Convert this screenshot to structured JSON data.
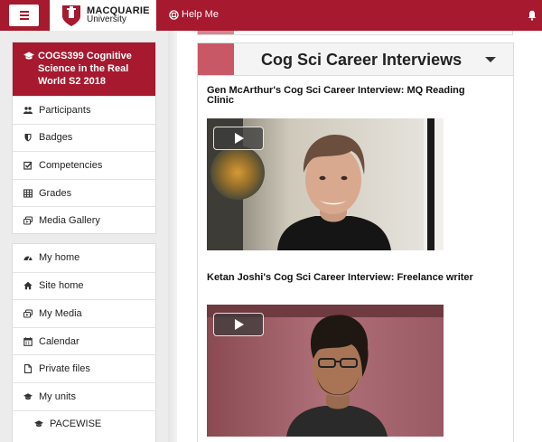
{
  "header": {
    "logo_line1": "MACQUARIE",
    "logo_line2": "University",
    "help_label": "Help Me"
  },
  "course": {
    "title": "COGS399 Cognitive Science in the Real World S2 2018",
    "items": [
      {
        "label": "Participants",
        "icon": "users-icon"
      },
      {
        "label": "Badges",
        "icon": "shield-icon"
      },
      {
        "label": "Competencies",
        "icon": "checkbox-icon"
      },
      {
        "label": "Grades",
        "icon": "table-icon"
      },
      {
        "label": "Media Gallery",
        "icon": "media-icon"
      }
    ]
  },
  "site_nav": {
    "items": [
      {
        "label": "My home",
        "icon": "dashboard-icon"
      },
      {
        "label": "Site home",
        "icon": "home-icon"
      },
      {
        "label": "My Media",
        "icon": "media-icon"
      },
      {
        "label": "Calendar",
        "icon": "calendar-icon"
      },
      {
        "label": "Private files",
        "icon": "file-icon"
      },
      {
        "label": "My units",
        "icon": "graduation-cap-icon"
      },
      {
        "label": "PACEWISE",
        "icon": "graduation-cap-icon"
      }
    ]
  },
  "section": {
    "title": "Cog Sci Career Interviews",
    "videos": [
      {
        "title": "Gen McArthur's Cog Sci Career Interview: MQ Reading Clinic"
      },
      {
        "title": "Ketan Joshi's Cog Sci Career Interview: Freelance writer"
      }
    ]
  },
  "colors": {
    "brand": "#a6192e",
    "section_accent": "#c85866"
  }
}
